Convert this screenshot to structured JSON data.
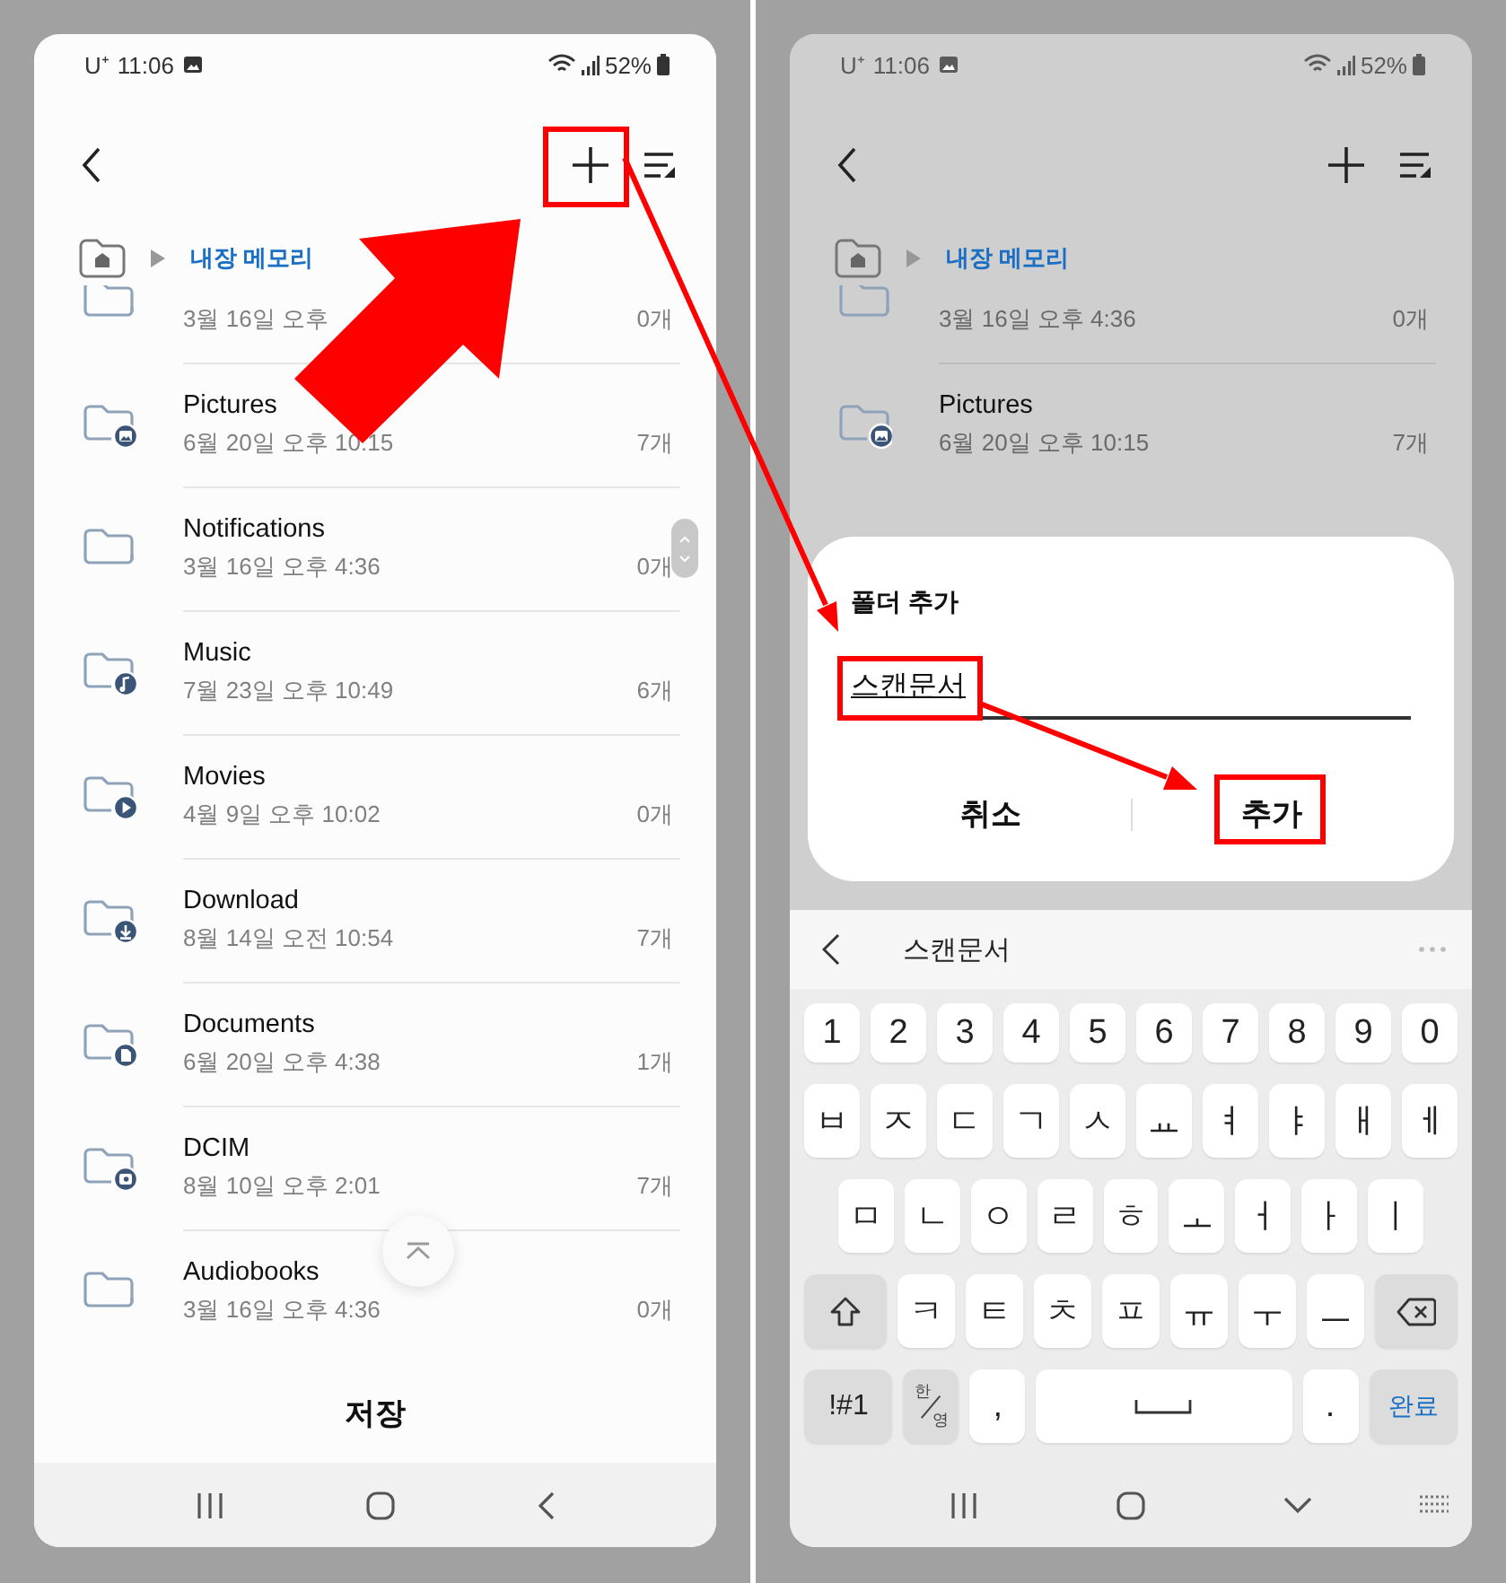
{
  "left_screen": {
    "status_bar": {
      "carrier": "U⁺",
      "time": "11:06",
      "battery": "52%"
    },
    "breadcrumb": {
      "path": "내장 메모리"
    },
    "files": [
      {
        "kind": "plain",
        "date": "3월 16일 오후",
        "count": "0개"
      },
      {
        "kind": "pictures",
        "name": "Pictures",
        "date": "6월 20일 오후 10:15",
        "count": "7개"
      },
      {
        "kind": "plain",
        "name": "Notifications",
        "date": "3월 16일 오후 4:36",
        "count": "0개"
      },
      {
        "kind": "music",
        "name": "Music",
        "date": "7월 23일 오후 10:49",
        "count": "6개"
      },
      {
        "kind": "movies",
        "name": "Movies",
        "date": "4월 9일 오후 10:02",
        "count": "0개"
      },
      {
        "kind": "download",
        "name": "Download",
        "date": "8월 14일 오전 10:54",
        "count": "7개"
      },
      {
        "kind": "documents",
        "name": "Documents",
        "date": "6월 20일 오후 4:38",
        "count": "1개"
      },
      {
        "kind": "camera",
        "name": "DCIM",
        "date": "8월 10일 오후 2:01",
        "count": "7개"
      },
      {
        "kind": "plain",
        "name": "Audiobooks",
        "date": "3월 16일 오후 4:36",
        "count": "0개"
      }
    ],
    "save_button": "저장"
  },
  "right_screen": {
    "status_bar": {
      "carrier": "U⁺",
      "time": "11:06",
      "battery": "52%"
    },
    "breadcrumb": {
      "path": "내장 메모리"
    },
    "files": [
      {
        "kind": "plain",
        "date": "3월 16일 오후 4:36",
        "count": "0개"
      },
      {
        "kind": "pictures",
        "name": "Pictures",
        "date": "6월 20일 오후 10:15",
        "count": "7개"
      }
    ],
    "dialog": {
      "title": "폴더 추가",
      "value": "스캔문서",
      "buttons": [
        "취소",
        "추가"
      ]
    },
    "keyboard": {
      "suggestion": "스캔문서",
      "rows": [
        {
          "keys": [
            {
              "kind": "char",
              "label": "1"
            },
            {
              "kind": "char",
              "label": "2"
            },
            {
              "kind": "char",
              "label": "3"
            },
            {
              "kind": "char",
              "label": "4"
            },
            {
              "kind": "char",
              "label": "5"
            },
            {
              "kind": "char",
              "label": "6"
            },
            {
              "kind": "char",
              "label": "7"
            },
            {
              "kind": "char",
              "label": "8"
            },
            {
              "kind": "char",
              "label": "9"
            },
            {
              "kind": "char",
              "label": "0"
            }
          ]
        },
        {
          "keys": [
            {
              "kind": "char",
              "label": "ㅂ"
            },
            {
              "kind": "char",
              "label": "ㅈ"
            },
            {
              "kind": "char",
              "label": "ㄷ"
            },
            {
              "kind": "char",
              "label": "ㄱ"
            },
            {
              "kind": "char",
              "label": "ㅅ"
            },
            {
              "kind": "char",
              "label": "ㅛ"
            },
            {
              "kind": "char",
              "label": "ㅕ"
            },
            {
              "kind": "char",
              "label": "ㅑ"
            },
            {
              "kind": "char",
              "label": "ㅐ"
            },
            {
              "kind": "char",
              "label": "ㅔ"
            }
          ]
        },
        {
          "keys": [
            {
              "kind": "char",
              "label": "ㅁ"
            },
            {
              "kind": "char",
              "label": "ㄴ"
            },
            {
              "kind": "char",
              "label": "ㅇ"
            },
            {
              "kind": "char",
              "label": "ㄹ"
            },
            {
              "kind": "char",
              "label": "ㅎ"
            },
            {
              "kind": "char",
              "label": "ㅗ"
            },
            {
              "kind": "char",
              "label": "ㅓ"
            },
            {
              "kind": "char",
              "label": "ㅏ"
            },
            {
              "kind": "char",
              "label": "ㅣ"
            }
          ]
        },
        {
          "keys": [
            {
              "kind": "shift"
            },
            {
              "kind": "char",
              "label": "ㅋ"
            },
            {
              "kind": "char",
              "label": "ㅌ"
            },
            {
              "kind": "char",
              "label": "ㅊ"
            },
            {
              "kind": "char",
              "label": "ㅍ"
            },
            {
              "kind": "char",
              "label": "ㅠ"
            },
            {
              "kind": "char",
              "label": "ㅜ"
            },
            {
              "kind": "char",
              "label": "ㅡ"
            },
            {
              "kind": "backspace"
            }
          ]
        },
        {
          "keys": [
            {
              "kind": "symbols",
              "label": "!#1"
            },
            {
              "kind": "lang",
              "label": "한",
              "sub": "영"
            },
            {
              "kind": "char",
              "label": ","
            },
            {
              "kind": "space"
            },
            {
              "kind": "char",
              "label": "."
            },
            {
              "kind": "done",
              "label": "완료"
            }
          ]
        }
      ]
    }
  }
}
